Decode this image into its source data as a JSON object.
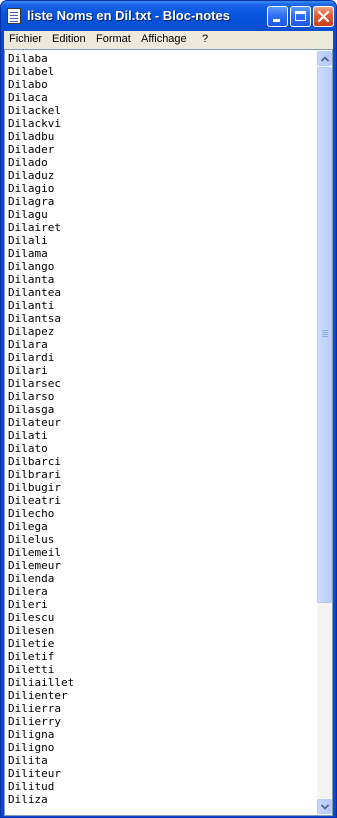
{
  "window": {
    "title": "liste Noms en Dil.txt - Bloc-notes",
    "icon": "notepad-icon",
    "buttons": {
      "minimize": "minimize-icon",
      "maximize": "maximize-icon",
      "close": "close-icon"
    }
  },
  "menu": {
    "fichier": "Fichier",
    "edition": "Edition",
    "format": "Format",
    "affichage": "Affichage",
    "help": "?"
  },
  "document": {
    "lines": [
      "Dilaba",
      "Dilabel",
      "Dilabo",
      "Dilaca",
      "Dilackel",
      "Dilackvi",
      "Diladbu",
      "Dilader",
      "Dilado",
      "Diladuz",
      "Dilagio",
      "Dilagra",
      "Dilagu",
      "Dilairet",
      "Dilali",
      "Dilama",
      "Dilango",
      "Dilanta",
      "Dilantea",
      "Dilanti",
      "Dilantsa",
      "Dilapez",
      "Dilara",
      "Dilardi",
      "Dilari",
      "Dilarsec",
      "Dilarso",
      "Dilasga",
      "Dilateur",
      "Dilati",
      "Dilato",
      "Dilbarci",
      "Dilbrari",
      "Dilbugir",
      "Dileatri",
      "Dilecho",
      "Dilega",
      "Dilelus",
      "Dilemeil",
      "Dilemeur",
      "Dilenda",
      "Dilera",
      "Dileri",
      "Dilescu",
      "Dilesen",
      "Diletie",
      "Diletif",
      "Diletti",
      "Diliaillet",
      "Dilienter",
      "Dilierra",
      "Dilierry",
      "Diligna",
      "Diligno",
      "Dilita",
      "Diliteur",
      "Dilitud",
      "Diliza"
    ]
  },
  "scrollbar": {
    "up": "arrow-up-icon",
    "down": "arrow-down-icon"
  },
  "colors": {
    "titlebar": "#0a56e0",
    "close_button": "#e05a30",
    "menubar": "#ece9d8"
  }
}
